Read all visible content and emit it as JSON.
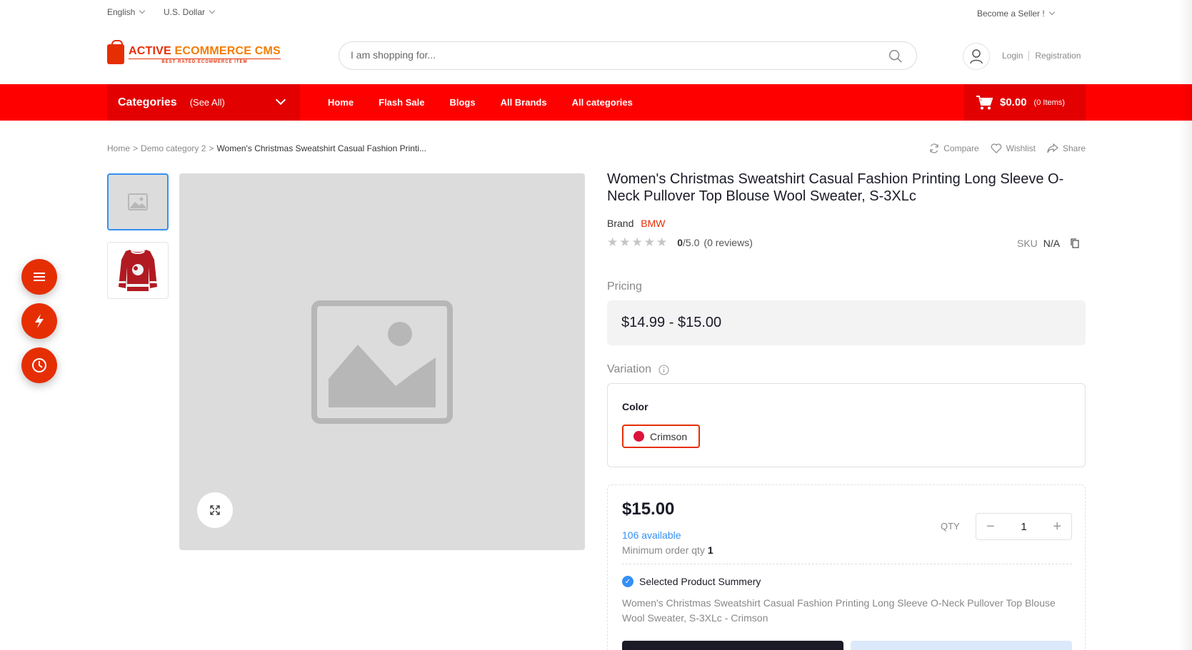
{
  "topbar": {
    "language": "English",
    "currency": "U.S. Dollar",
    "become_seller": "Become a Seller !"
  },
  "header": {
    "logo_title_a": "ACTIVE ",
    "logo_title_b": "ECOMMERCE CMS",
    "logo_subtitle": "BEST RATED ECOMMERCE ITEM",
    "search_placeholder": "I am shopping for...",
    "login": "Login",
    "registration": "Registration"
  },
  "nav": {
    "categories": "Categories",
    "see_all": "(See All)",
    "links": [
      "Home",
      "Flash Sale",
      "Blogs",
      "All Brands",
      "All categories"
    ],
    "cart_amount": "$0.00",
    "cart_items": "(0 Items)"
  },
  "breadcrumb": {
    "home": "Home",
    "sep": ">",
    "category": "Demo category 2",
    "current": "Women's Christmas Sweatshirt Casual Fashion Printi..."
  },
  "actions": {
    "compare": "Compare",
    "wishlist": "Wishlist",
    "share": "Share"
  },
  "product": {
    "title": "Women's Christmas Sweatshirt Casual Fashion Printing Long Sleeve O-Neck Pullover Top Blouse Wool Sweater, S-3XLc",
    "brand_label": "Brand",
    "brand_value": "BMW",
    "rating_value": "0",
    "rating_max": "/5.0",
    "reviews": "(0 reviews)",
    "sku_label": "SKU",
    "sku_value": "N/A",
    "pricing_label": "Pricing",
    "price_range": "$14.99 - $15.00",
    "variation_label": "Variation",
    "color_label": "Color",
    "color_option": "Crimson",
    "color_hex": "#dc143c",
    "total_price": "$15.00",
    "available": "106 available",
    "min_order_label": "Minimum order qty",
    "min_order_value": "1",
    "qty_label": "QTY",
    "qty_value": "1",
    "summary_label": "Selected Product Summery",
    "summary_text": "Women's Christmas Sweatshirt Casual Fashion Printing Long Sleeve O-Neck Pullover Top Blouse Wool Sweater, S-3XLc - Crimson"
  },
  "colors": {
    "accent": "#e62e04",
    "nav_red": "#ff0000",
    "link_blue": "#3490f3"
  },
  "icons": {
    "fab_1": "menu-icon",
    "fab_2": "flash-icon",
    "fab_3": "clock-icon"
  }
}
